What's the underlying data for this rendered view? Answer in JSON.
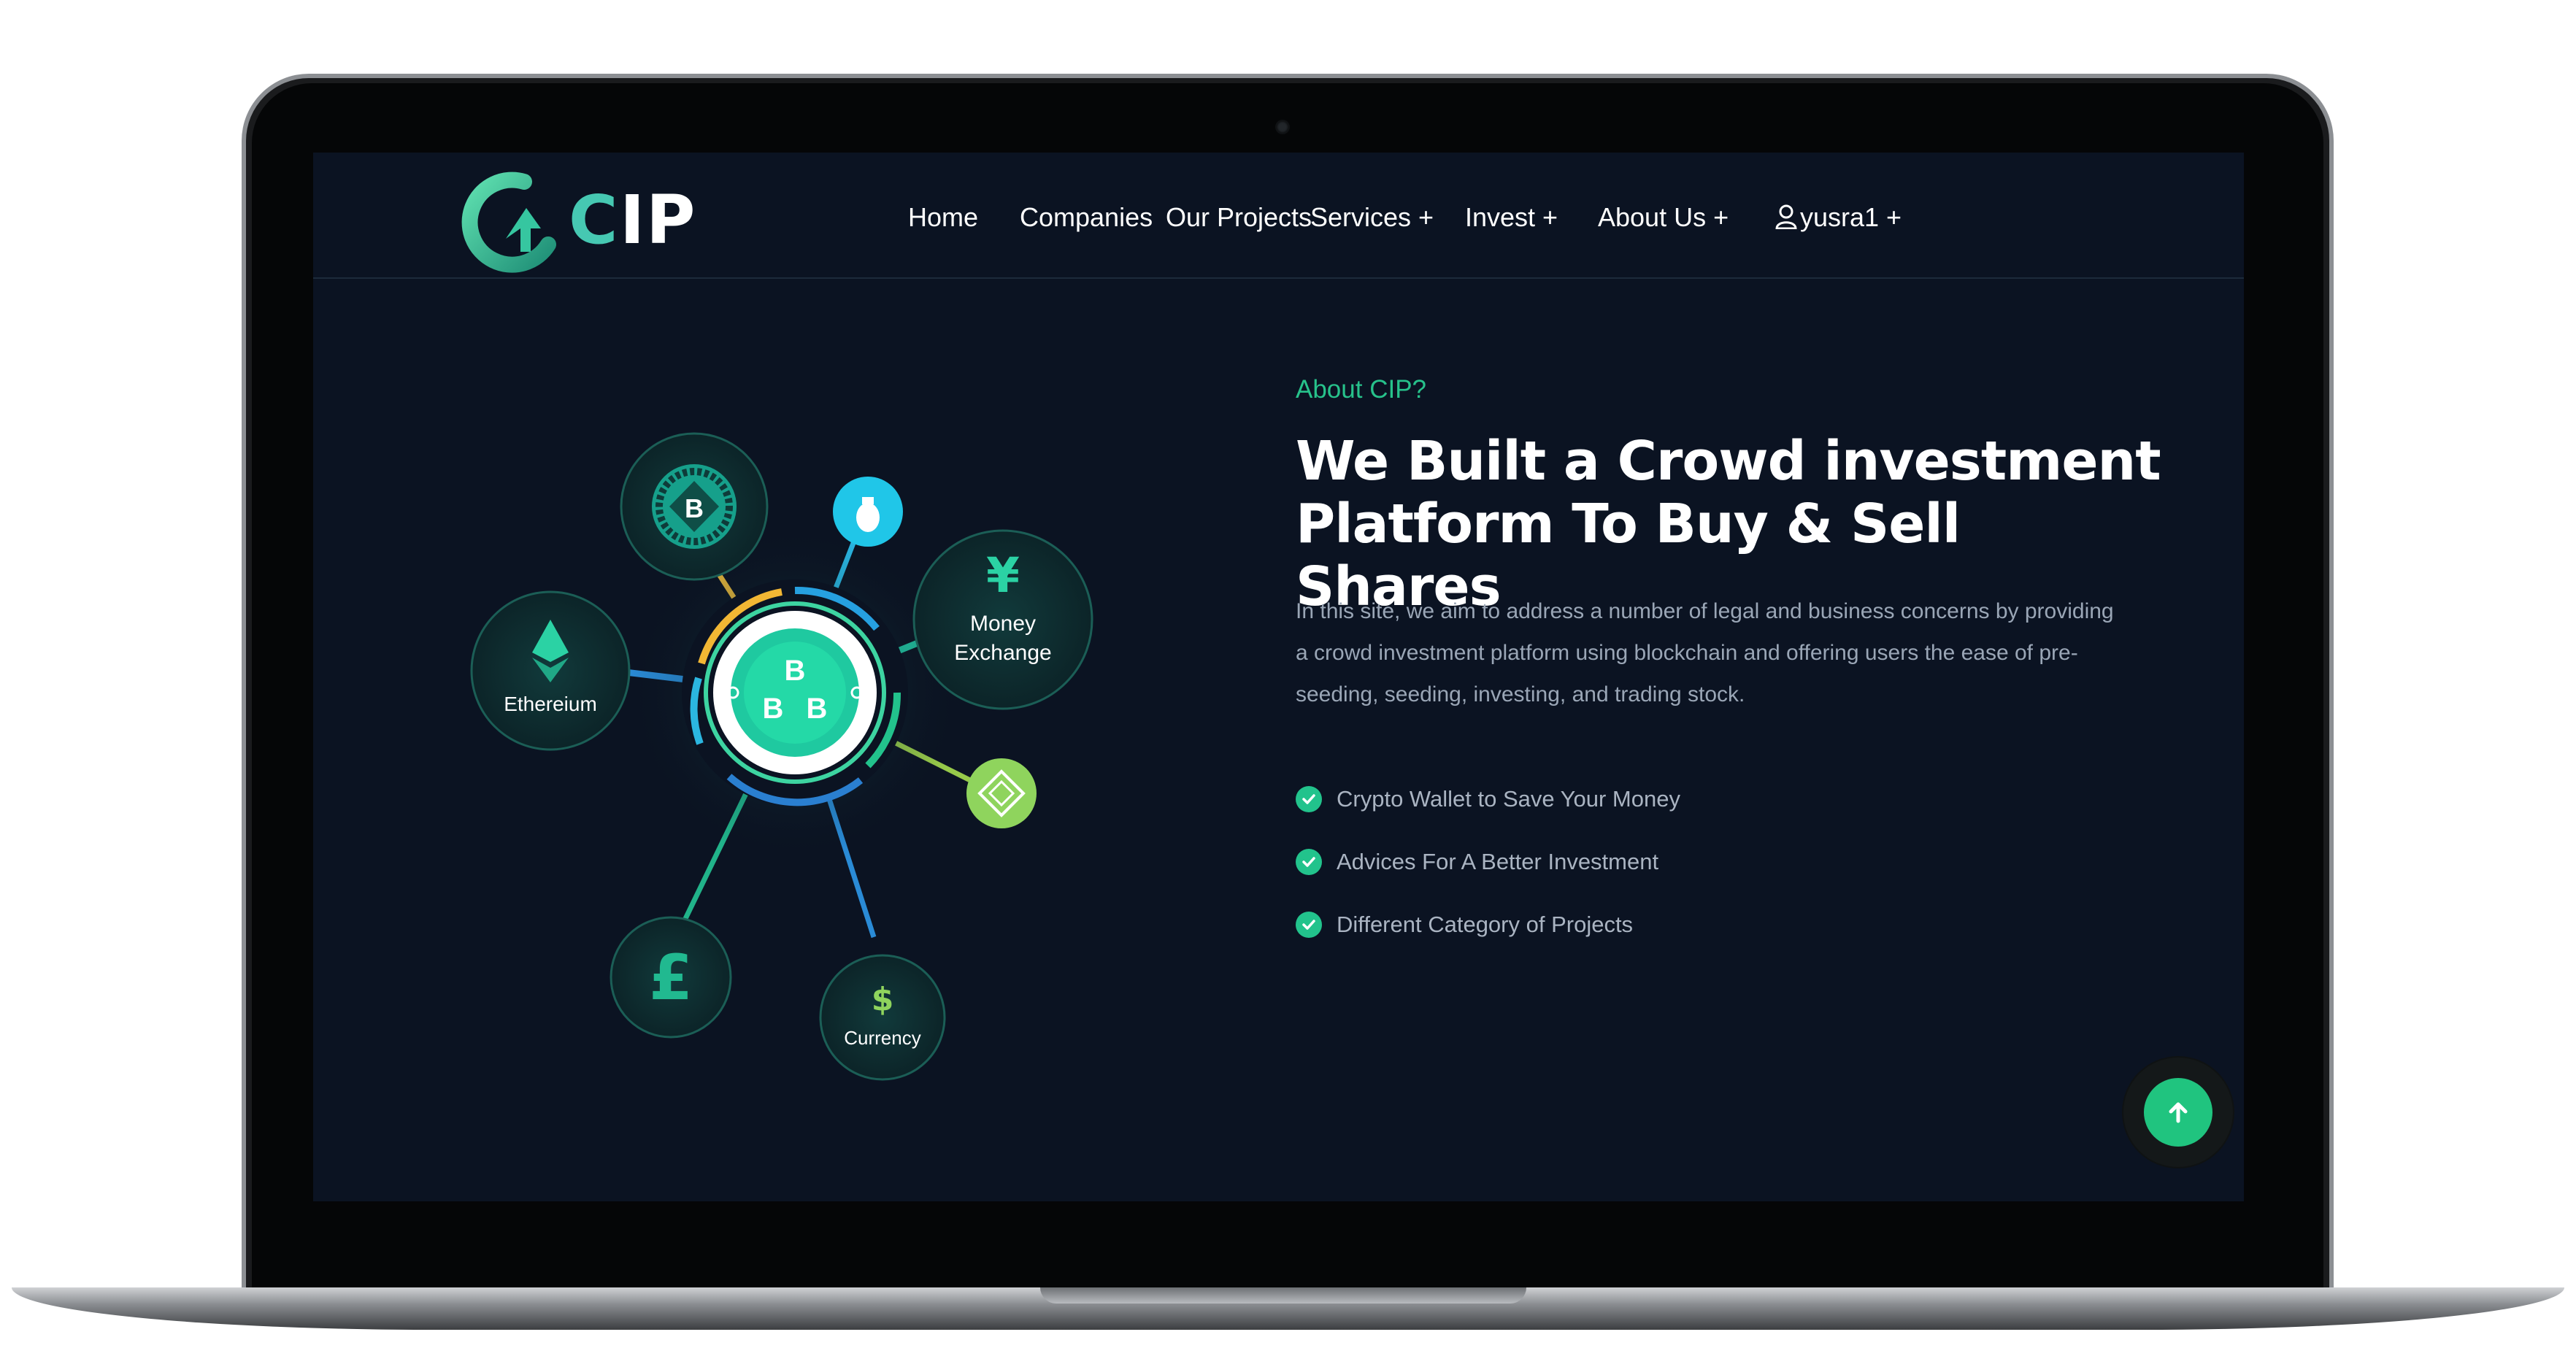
{
  "brand": {
    "logo_text": "CIP"
  },
  "nav": {
    "items": [
      {
        "label": "Home"
      },
      {
        "label": "Companies"
      },
      {
        "label": "Our Projects"
      },
      {
        "label": "Services +"
      },
      {
        "label": "Invest +"
      },
      {
        "label": "About Us +"
      }
    ],
    "user": {
      "label": "yusra1 +",
      "icon": "user-icon"
    }
  },
  "about": {
    "eyebrow": "About CIP?",
    "headline_line1": "We Built a Crowd investment",
    "headline_line2": "Platform To Buy & Sell Shares",
    "description": "In this site, we aim to address a number of legal and business concerns by providing a crowd investment platform using blockchain and offering users the ease of pre-seeding, seeding, investing, and trading stock.",
    "features": [
      {
        "label": "Crypto Wallet to Save Your Money"
      },
      {
        "label": "Advices For A Better Investment"
      },
      {
        "label": "Different Category of Projects"
      }
    ]
  },
  "illustration": {
    "nodes": {
      "ethereum": "Ethereium",
      "money_exchange_line1": "Money",
      "money_exchange_line2": "Exchange",
      "currency": "Currency",
      "yen_symbol": "¥",
      "pound_symbol": "£",
      "dollar_symbol": "$",
      "bitcoin_symbol": "B"
    }
  },
  "back_to_top": {
    "icon": "arrow-up-icon"
  },
  "colors": {
    "background": "#0b1322",
    "accent": "#27c28b",
    "text_muted": "#9aa6b6"
  }
}
